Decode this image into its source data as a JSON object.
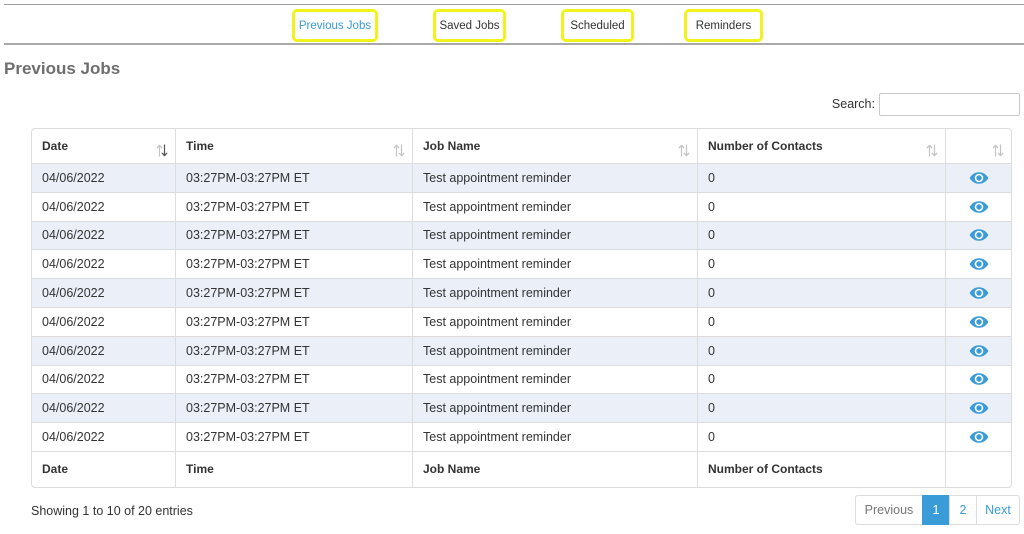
{
  "colors": {
    "accent": "#3a9bd9",
    "tab_highlight": "#f3f31c",
    "row_stripe": "#eaeff8",
    "title": "#6e6e6e"
  },
  "icons": {
    "sort": "sort-icon",
    "row_action": "eye-icon"
  },
  "tabs": [
    {
      "label": "Previous Jobs",
      "active": true
    },
    {
      "label": "Saved Jobs",
      "active": false
    },
    {
      "label": "Scheduled",
      "active": false
    },
    {
      "label": "Reminders",
      "active": false
    }
  ],
  "page_title": "Previous Jobs",
  "search": {
    "label": "Search:",
    "value": ""
  },
  "table": {
    "columns": [
      {
        "label": "Date",
        "sort": "desc"
      },
      {
        "label": "Time",
        "sort": "none"
      },
      {
        "label": "Job Name",
        "sort": "none"
      },
      {
        "label": "Number of Contacts",
        "sort": "none"
      },
      {
        "sort": "none"
      }
    ],
    "rows": [
      {
        "date": "04/06/2022",
        "time": "03:27PM-03:27PM ET",
        "job_name": "Test appointment reminder",
        "contacts": 0
      },
      {
        "date": "04/06/2022",
        "time": "03:27PM-03:27PM ET",
        "job_name": "Test appointment reminder",
        "contacts": 0
      },
      {
        "date": "04/06/2022",
        "time": "03:27PM-03:27PM ET",
        "job_name": "Test appointment reminder",
        "contacts": 0
      },
      {
        "date": "04/06/2022",
        "time": "03:27PM-03:27PM ET",
        "job_name": "Test appointment reminder",
        "contacts": 0
      },
      {
        "date": "04/06/2022",
        "time": "03:27PM-03:27PM ET",
        "job_name": "Test appointment reminder",
        "contacts": 0
      },
      {
        "date": "04/06/2022",
        "time": "03:27PM-03:27PM ET",
        "job_name": "Test appointment reminder",
        "contacts": 0
      },
      {
        "date": "04/06/2022",
        "time": "03:27PM-03:27PM ET",
        "job_name": "Test appointment reminder",
        "contacts": 0
      },
      {
        "date": "04/06/2022",
        "time": "03:27PM-03:27PM ET",
        "job_name": "Test appointment reminder",
        "contacts": 0
      },
      {
        "date": "04/06/2022",
        "time": "03:27PM-03:27PM ET",
        "job_name": "Test appointment reminder",
        "contacts": 0
      },
      {
        "date": "04/06/2022",
        "time": "03:27PM-03:27PM ET",
        "job_name": "Test appointment reminder",
        "contacts": 0
      }
    ],
    "footer": [
      "Date",
      "Time",
      "Job Name",
      "Number of Contacts"
    ]
  },
  "info": "Showing 1 to 10 of 20 entries",
  "pagination": {
    "previous": "Previous",
    "pages": [
      {
        "label": "1",
        "active": true
      },
      {
        "label": "2",
        "active": false
      }
    ],
    "next": "Next"
  }
}
